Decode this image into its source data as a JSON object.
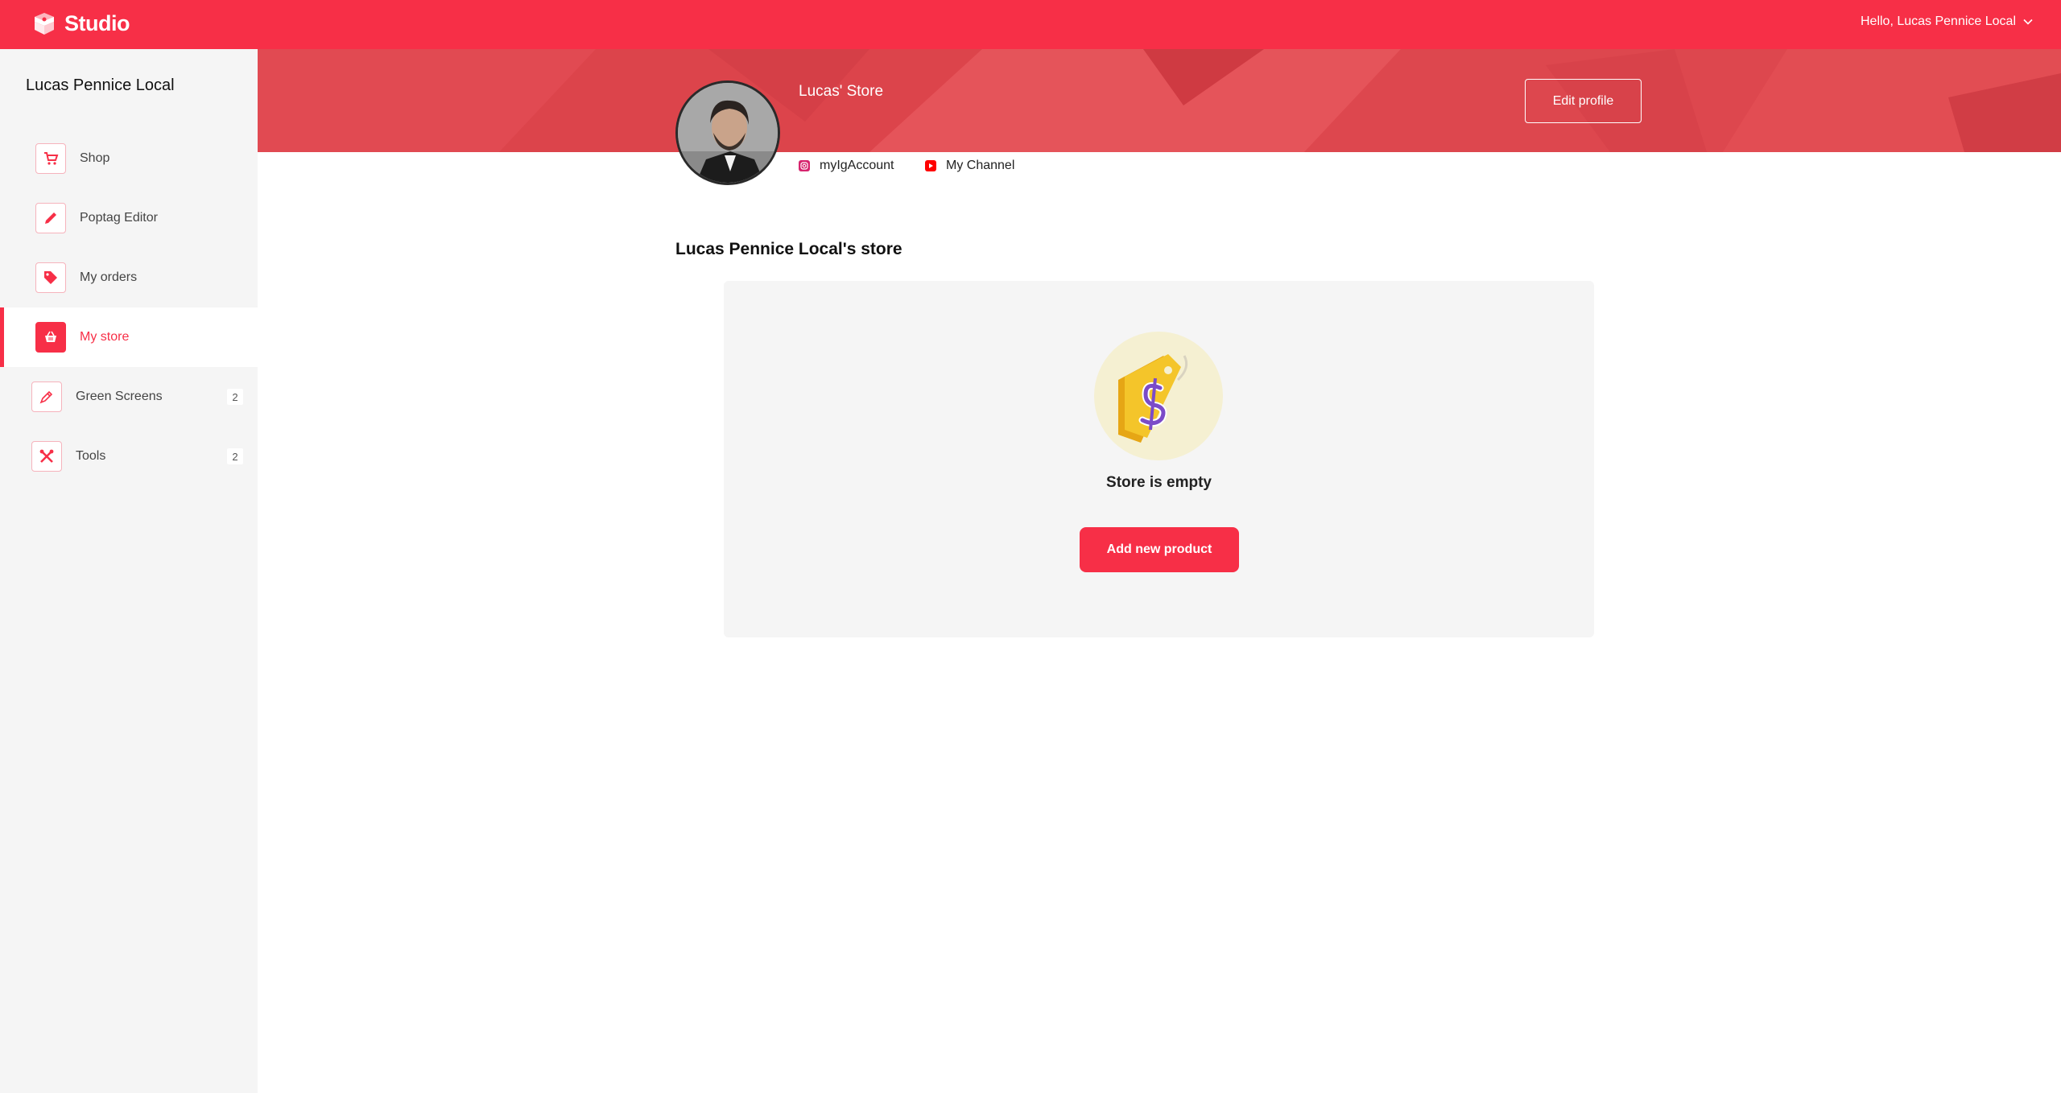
{
  "topbar": {
    "brand": "Studio",
    "greeting": "Hello, Lucas Pennice Local",
    "color": "#f72f47"
  },
  "sidebar": {
    "user_name": "Lucas Pennice Local",
    "items": [
      {
        "label": "Shop",
        "icon": "cart-icon"
      },
      {
        "label": "Poptag Editor",
        "icon": "pencil-icon"
      },
      {
        "label": "My orders",
        "icon": "tag-icon"
      },
      {
        "label": "My store",
        "icon": "basket-icon",
        "active": true
      },
      {
        "label": "Green Screens",
        "icon": "pen-icon",
        "badge": "2"
      },
      {
        "label": "Tools",
        "icon": "tools-icon",
        "badge": "2"
      }
    ]
  },
  "profile": {
    "store_name": "Lucas' Store",
    "edit_label": "Edit profile",
    "instagram": "myIgAccount",
    "youtube": "My Channel"
  },
  "main": {
    "section_title": "Lucas Pennice Local's store",
    "empty_text": "Store is empty",
    "add_button": "Add new product"
  }
}
